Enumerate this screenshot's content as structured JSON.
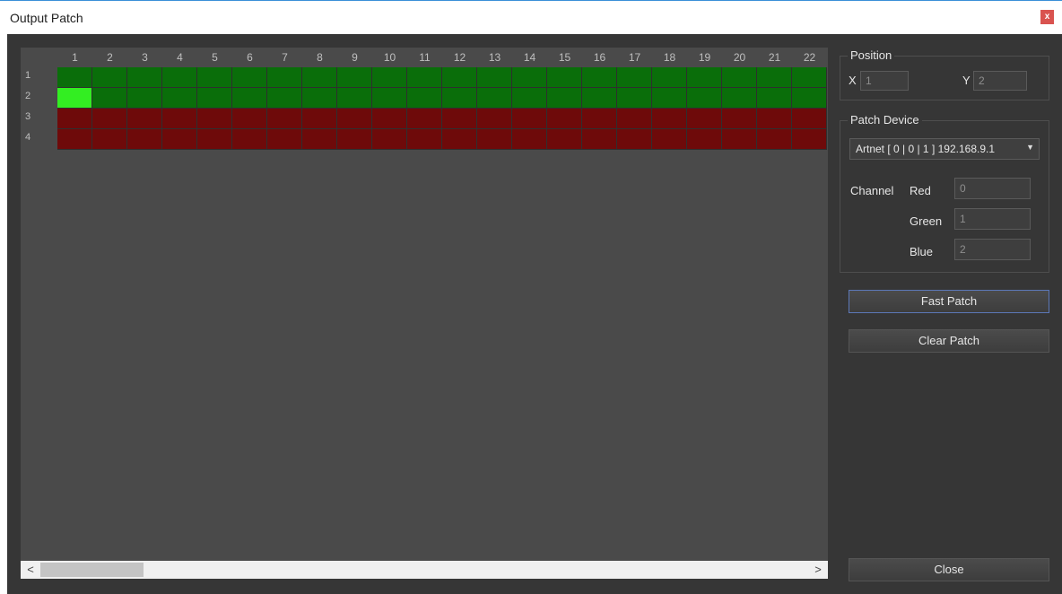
{
  "window": {
    "title": "Output Patch",
    "close_glyph": "x"
  },
  "grid": {
    "columns": [
      "1",
      "2",
      "3",
      "4",
      "5",
      "6",
      "7",
      "8",
      "9",
      "10",
      "11",
      "12",
      "13",
      "14",
      "15",
      "16",
      "17",
      "18",
      "19",
      "20",
      "21",
      "22"
    ],
    "rows": [
      {
        "label": "1",
        "state": "patched"
      },
      {
        "label": "2",
        "state": "patched"
      },
      {
        "label": "3",
        "state": "unpatched"
      },
      {
        "label": "4",
        "state": "unpatched"
      }
    ],
    "selected": {
      "row": 2,
      "col": 1
    },
    "colors": {
      "patched": "#0a6e0a",
      "unpatched": "#6e0a0a",
      "selected": "#33ee22"
    }
  },
  "scrollbar": {
    "left_glyph": "<",
    "right_glyph": ">"
  },
  "position": {
    "legend": "Position",
    "x_label": "X",
    "x_value": "1",
    "y_label": "Y",
    "y_value": "2"
  },
  "patch_device": {
    "legend": "Patch Device",
    "selected": "Artnet [ 0 | 0 | 1 ] 192.168.9.1",
    "channel_label": "Channel",
    "red_label": "Red",
    "red_value": "0",
    "green_label": "Green",
    "green_value": "1",
    "blue_label": "Blue",
    "blue_value": "2"
  },
  "buttons": {
    "fast_patch": "Fast Patch",
    "clear_patch": "Clear Patch",
    "close": "Close"
  }
}
